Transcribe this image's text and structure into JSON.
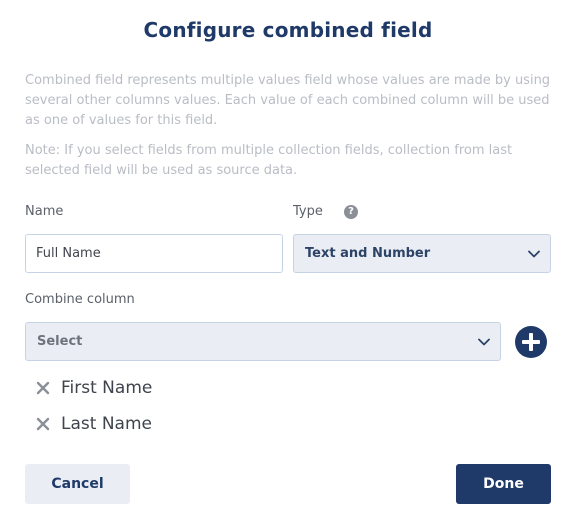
{
  "dialog": {
    "title": "Configure combined field",
    "description": "Combined field represents multiple values field whose values are made by using several other columns values. Each value of each combined column will be used as one of values for this field.",
    "note": "Note: If you select fields from multiple collection fields, collection from last selected field will be used as source data."
  },
  "form": {
    "name_label": "Name",
    "name_value": "Full Name",
    "type_label": "Type",
    "help_icon": "question-icon",
    "type_value": "Text and Number",
    "combine_label": "Combine column",
    "combine_placeholder": "Select"
  },
  "combined_columns": [
    "First Name",
    "Last Name"
  ],
  "actions": {
    "cancel_label": "Cancel",
    "done_label": "Done"
  },
  "colors": {
    "primary": "#1f3a68",
    "muted_text": "#b9bdc4",
    "select_bg": "#eaeef4"
  }
}
